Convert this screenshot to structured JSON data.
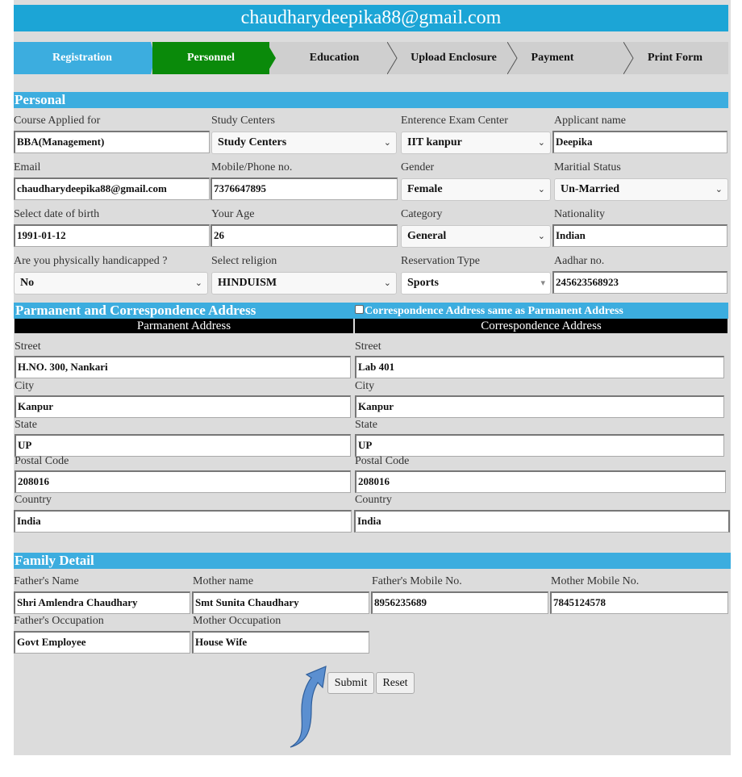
{
  "banner": {
    "email": "chaudharydeepika88@gmail.com"
  },
  "wizard": {
    "steps": [
      "Registration",
      "Personnel",
      "Education",
      "Upload Enclosure",
      "Payment",
      "Print Form"
    ],
    "colors": {
      "done": "#3caddf",
      "active": "#0a8a0a",
      "pending": "#cfcfcf"
    }
  },
  "personal": {
    "heading": "Personal",
    "course_label": "Course Applied for",
    "course_value": "BBA(Management)",
    "study_label": "Study Centers",
    "study_value": "Study Centers",
    "exam_label": "Enterence Exam Center",
    "exam_value": "IIT kanpur",
    "name_label": "Applicant name",
    "name_value": "Deepika",
    "email_label": "Email",
    "email_value": "chaudharydeepika88@gmail.com",
    "mobile_label": "Mobile/Phone no.",
    "mobile_value": "7376647895",
    "gender_label": "Gender",
    "gender_value": "Female",
    "marital_label": "Maritial Status",
    "marital_value": "Un-Married",
    "dob_label": "Select date of birth",
    "dob_value": "1991-01-12",
    "age_label": "Your Age",
    "age_value": "26",
    "category_label": "Category",
    "category_value": "General",
    "nationality_label": "Nationality",
    "nationality_value": "Indian",
    "handicap_label": "Are you physically handicapped ?",
    "handicap_value": "No",
    "religion_label": "Select religion",
    "religion_value": "HINDUISM",
    "reservation_label": "Reservation Type",
    "reservation_value": "Sports",
    "aadhar_label": "Aadhar no.",
    "aadhar_value": "245623568923"
  },
  "address": {
    "heading": "Parmanent and Correspondence Address",
    "same_label": "Correspondence Address same as Parmanent Address",
    "perm_heading": "Parmanent Address",
    "corr_heading": "Correspondence Address",
    "street_label": "Street",
    "city_label": "City",
    "state_label": "State",
    "postal_label": "Postal Code",
    "country_label": "Country",
    "perm": {
      "street": "H.NO. 300, Nankari",
      "city": "Kanpur",
      "state": "UP",
      "postal": "208016",
      "country": "India"
    },
    "corr": {
      "street": "Lab 401",
      "city": "Kanpur",
      "state": "UP",
      "postal": "208016",
      "country": "India"
    }
  },
  "family": {
    "heading": "Family Detail",
    "father_name_label": "Father's Name",
    "father_name_value": "Shri Amlendra Chaudhary",
    "mother_name_label": "Mother name",
    "mother_name_value": "Smt Sunita Chaudhary",
    "father_mobile_label": "Father's Mobile No.",
    "father_mobile_value": "8956235689",
    "mother_mobile_label": "Mother Mobile No.",
    "mother_mobile_value": "7845124578",
    "father_occ_label": "Father's Occupation",
    "father_occ_value": "Govt Employee",
    "mother_occ_label": "Mother Occupation",
    "mother_occ_value": "House Wife"
  },
  "actions": {
    "submit": "Submit",
    "reset": "Reset"
  },
  "icons": {
    "arrow": "curved-arrow-icon",
    "chevron": "chevron-down-icon"
  },
  "colors": {
    "accent": "#3caddf",
    "banner": "#1ca5d6",
    "background": "#dcdcdc"
  }
}
